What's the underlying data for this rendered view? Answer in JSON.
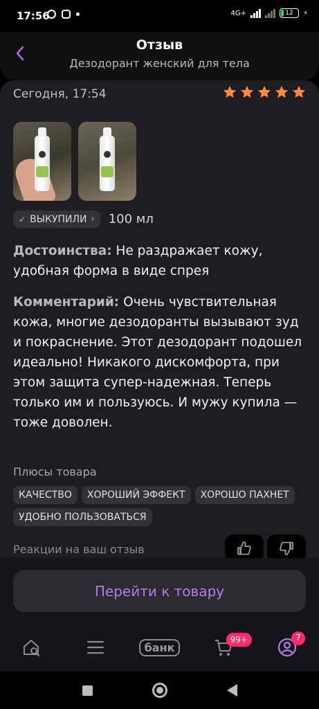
{
  "status_bar": {
    "time": "17:56",
    "battery": "12",
    "network": "4G+"
  },
  "header": {
    "title": "Отзыв",
    "subtitle": "Дезодорант женский для тела"
  },
  "review": {
    "date": "Сегодня, 17:54",
    "rating": 5,
    "purchased_badge": "ВЫКУПИЛИ",
    "volume": "100 мл",
    "advantages_label": "Достоинства:",
    "advantages_text": " Не раздражает кожу, удобная форма в виде спрея",
    "comment_label": "Комментарий:",
    "comment_text": " Очень чувствительная кожа, многие дезодоранты вызывают зуд и покраснение. Этот дезодорант подошел идеально! Никакого дискомфорта, при этом защита супер-надежная. Теперь только им и пользуюсь. И мужу купила — тоже доволен."
  },
  "pluses": {
    "title": "Плюсы товара",
    "tags": [
      "КАЧЕСТВО",
      "ХОРОШИЙ ЭФФЕКТ",
      "ХОРОШО ПАХНЕТ",
      "УДОБНО ПОЛЬЗОВАТЬСЯ"
    ]
  },
  "reactions": {
    "label": "Реакции на ваш отзыв"
  },
  "cta": {
    "label": "Перейти к товару"
  },
  "tabbar": {
    "bank_label": "банк",
    "cart_badge": "99+",
    "profile_badge": "7"
  },
  "colors": {
    "accent": "#b77be8",
    "star": "#ff8a3d",
    "badge": "#ff2e6a"
  }
}
